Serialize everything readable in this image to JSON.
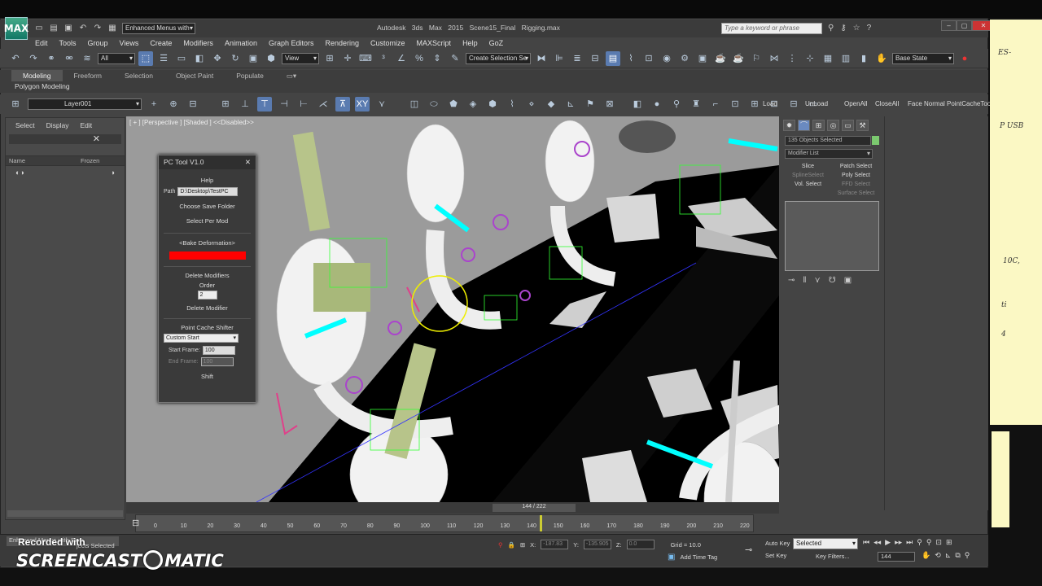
{
  "titlebar": {
    "workspace": "Enhanced Menus with",
    "app_title": "Autodesk 3ds Max 2015",
    "file_name": "Scene15_Final Rigging.max",
    "search_placeholder": "Type a keyword or phrase",
    "logo": "MAX"
  },
  "menus": [
    "Edit",
    "Tools",
    "Group",
    "Views",
    "Create",
    "Modifiers",
    "Animation",
    "Graph Editors",
    "Rendering",
    "Customize",
    "MAXScript",
    "Help",
    "GoZ"
  ],
  "toolbar": {
    "filter": "All",
    "ref_coord": "View",
    "selection_set": "Create Selection Se",
    "state": "Base State"
  },
  "ribbon": {
    "tabs": [
      "Modeling",
      "Freeform",
      "Selection",
      "Object Paint",
      "Populate"
    ],
    "active_tab": "Modeling",
    "sub": "Polygon Modeling"
  },
  "layer": {
    "name": "Layer001"
  },
  "toolbar2_right": [
    "Load",
    "UnLoad",
    "OpenAll",
    "CloseAll",
    "Face Normal",
    "PointCacheToo"
  ],
  "scene_explorer": {
    "menu": [
      "Select",
      "Display",
      "Edit"
    ],
    "col_name": "Name",
    "col_frozen": "Frozen"
  },
  "viewport": {
    "label": "[ + ] [Perspective ] [Shaded ]  <<Disabled>>"
  },
  "pc_tool": {
    "title": "PC Tool V1.0",
    "help": "Help",
    "path_label": "Path",
    "path_value": "D:\\Desktop\\TestPC",
    "choose_folder": "Choose Save Folder",
    "select_per_mod": "Select Per Mod",
    "bake": "<Bake Deformation>",
    "delete_modifiers": "Delete Modifiers",
    "order_label": "Order",
    "order_value": "2",
    "delete_modifier": "Delete Modifier",
    "shifter_label": "Point Cache Shifter",
    "shifter_mode": "Custom Start",
    "start_frame_label": "Start Frame:",
    "start_frame": "100",
    "end_frame_label": "End Frame:",
    "end_frame": "100",
    "shift": "Shift",
    "bake_color": "#ff0000"
  },
  "command_panel": {
    "selected": "135 Objects Selected",
    "modifier_list": "Modifier List",
    "buttons": [
      "Slice",
      "Patch Select",
      "SplineSelect",
      "Poly Select",
      "Vol. Select",
      "FFD Select",
      "",
      "Surface Select"
    ]
  },
  "timeline": {
    "frame": "144 / 222",
    "ticks": [
      "0",
      "10",
      "20",
      "30",
      "40",
      "50",
      "60",
      "70",
      "80",
      "90",
      "100",
      "110",
      "120",
      "130",
      "140",
      "150",
      "160",
      "170",
      "180",
      "190",
      "200",
      "210",
      "220"
    ]
  },
  "status": {
    "listener": "Enhanced Menus with Sam",
    "selected_text": "jects Selected",
    "x": "-187.83",
    "y": "-135.905",
    "z": "0.0",
    "grid": "Grid = 10.0",
    "add_time_tag": "Add Time Tag",
    "auto_key": "Auto Key",
    "key_mode": "Selected",
    "set_key": "Set Key",
    "key_filters": "Key Filters...",
    "frame_field": "144"
  },
  "watermark": {
    "recorded": "Recorded with",
    "brand": "SCREENCAST",
    "brand2": "MATIC"
  },
  "notes": [
    "ES-",
    "P USB",
    "10C,",
    "ti",
    "4"
  ]
}
